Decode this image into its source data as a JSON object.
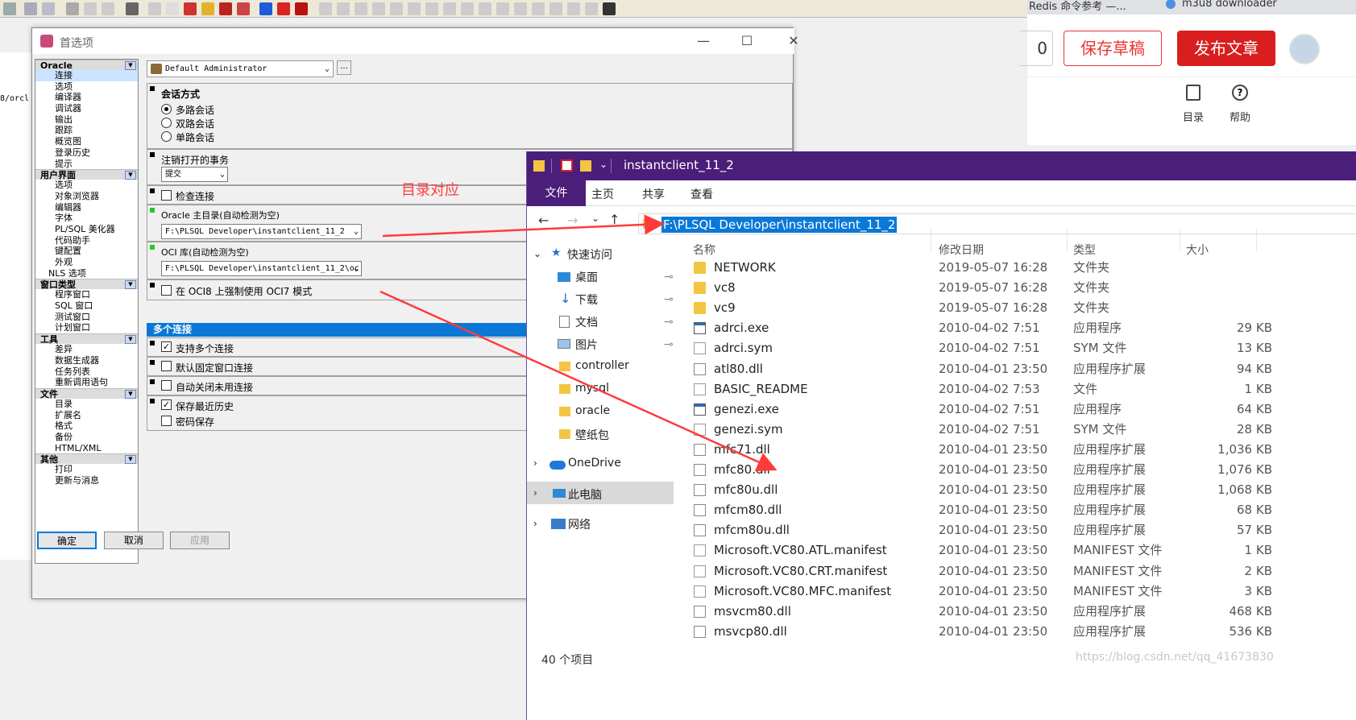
{
  "browser": {
    "tab1": "Redis 命令参考 —...",
    "tab2": "m3u8 downloader",
    "draft_label": "保存草稿",
    "publish_label": "发布文章",
    "toc_label": "目录",
    "help_label": "帮助",
    "partial_text": "0"
  },
  "left_strip_text": "8/orcl",
  "pref": {
    "title": "首选项",
    "profile": "Default Administrator",
    "profile_btn": "...",
    "tree": [
      {
        "cat": "Oracle",
        "items": [
          "连接",
          "选项",
          "编译器",
          "调试器",
          "输出",
          "跟踪",
          "概览图",
          "登录历史",
          "提示"
        ]
      },
      {
        "cat": "用户界面",
        "items": [
          "选项",
          "对象浏览器",
          "编辑器",
          "字体",
          "PL/SQL 美化器",
          "代码助手",
          "键配置",
          "外观",
          "NLS 选项"
        ]
      },
      {
        "cat": "窗口类型",
        "items": [
          "程序窗口",
          "SQL 窗口",
          "测试窗口",
          "计划窗口"
        ]
      },
      {
        "cat": "工具",
        "items": [
          "差异",
          "数据生成器",
          "任务列表",
          "重新调用语句"
        ]
      },
      {
        "cat": "文件",
        "items": [
          "目录",
          "扩展名",
          "格式",
          "备份",
          "HTML/XML"
        ]
      },
      {
        "cat": "其他",
        "items": [
          "打印",
          "更新与消息"
        ]
      }
    ],
    "session_title": "会话方式",
    "session_opts": [
      "多路会话",
      "双路会话",
      "单路会话"
    ],
    "commit_title": "注销打开的事务",
    "commit_value": "提交",
    "check_conn": "检查连接",
    "oracle_home_label": "Oracle 主目录(自动检测为空)",
    "oracle_home_value": "F:\\PLSQL Developer\\instantclient_11_2",
    "oci_label": "OCI 库(自动检测为空)",
    "oci_value": "F:\\PLSQL Developer\\instantclient_11_2\\oc",
    "force_oci7": "在 OCI8 上强制使用 OCI7 模式",
    "multi_header": "多个连接",
    "support_multi": "支持多个连接",
    "default_fixed": "默认固定窗口连接",
    "auto_close": "自动关闭未用连接",
    "save_history": "保存最近历史",
    "pwd_save": "密码保存",
    "ok": "确定",
    "cancel": "取消",
    "apply": "应用"
  },
  "annotation": "目录对应",
  "explorer": {
    "title": "instantclient_11_2",
    "ribbon": [
      "文件",
      "主页",
      "共享",
      "查看"
    ],
    "address": "F:\\PLSQL Developer\\instantclient_11_2",
    "columns": [
      "名称",
      "修改日期",
      "类型",
      "大小"
    ],
    "nav": {
      "quick": "快速访问",
      "pinned": [
        "桌面",
        "下载",
        "文档",
        "图片"
      ],
      "folders": [
        "controller",
        "mysql",
        "oracle",
        "壁纸包"
      ],
      "onedrive": "OneDrive",
      "thispc": "此电脑",
      "network": "网络"
    },
    "files": [
      {
        "name": "NETWORK",
        "date": "2019-05-07 16:28",
        "type": "文件夹",
        "size": "",
        "icon": "folder-icon"
      },
      {
        "name": "vc8",
        "date": "2019-05-07 16:28",
        "type": "文件夹",
        "size": "",
        "icon": "folder-icon"
      },
      {
        "name": "vc9",
        "date": "2019-05-07 16:28",
        "type": "文件夹",
        "size": "",
        "icon": "folder-icon"
      },
      {
        "name": "adrci.exe",
        "date": "2010-04-02 7:51",
        "type": "应用程序",
        "size": "29 KB",
        "icon": "exe-icon"
      },
      {
        "name": "adrci.sym",
        "date": "2010-04-02 7:51",
        "type": "SYM 文件",
        "size": "13 KB",
        "icon": "file-icon"
      },
      {
        "name": "atl80.dll",
        "date": "2010-04-01 23:50",
        "type": "应用程序扩展",
        "size": "94 KB",
        "icon": "dll-icon"
      },
      {
        "name": "BASIC_README",
        "date": "2010-04-02 7:53",
        "type": "文件",
        "size": "1 KB",
        "icon": "file-icon"
      },
      {
        "name": "genezi.exe",
        "date": "2010-04-02 7:51",
        "type": "应用程序",
        "size": "64 KB",
        "icon": "exe-icon"
      },
      {
        "name": "genezi.sym",
        "date": "2010-04-02 7:51",
        "type": "SYM 文件",
        "size": "28 KB",
        "icon": "file-icon"
      },
      {
        "name": "mfc71.dll",
        "date": "2010-04-01 23:50",
        "type": "应用程序扩展",
        "size": "1,036 KB",
        "icon": "dll-icon"
      },
      {
        "name": "mfc80.dll",
        "date": "2010-04-01 23:50",
        "type": "应用程序扩展",
        "size": "1,076 KB",
        "icon": "dll-icon"
      },
      {
        "name": "mfc80u.dll",
        "date": "2010-04-01 23:50",
        "type": "应用程序扩展",
        "size": "1,068 KB",
        "icon": "dll-icon"
      },
      {
        "name": "mfcm80.dll",
        "date": "2010-04-01 23:50",
        "type": "应用程序扩展",
        "size": "68 KB",
        "icon": "dll-icon"
      },
      {
        "name": "mfcm80u.dll",
        "date": "2010-04-01 23:50",
        "type": "应用程序扩展",
        "size": "57 KB",
        "icon": "dll-icon"
      },
      {
        "name": "Microsoft.VC80.ATL.manifest",
        "date": "2010-04-01 23:50",
        "type": "MANIFEST 文件",
        "size": "1 KB",
        "icon": "file-icon"
      },
      {
        "name": "Microsoft.VC80.CRT.manifest",
        "date": "2010-04-01 23:50",
        "type": "MANIFEST 文件",
        "size": "2 KB",
        "icon": "file-icon"
      },
      {
        "name": "Microsoft.VC80.MFC.manifest",
        "date": "2010-04-01 23:50",
        "type": "MANIFEST 文件",
        "size": "3 KB",
        "icon": "file-icon"
      },
      {
        "name": "msvcm80.dll",
        "date": "2010-04-01 23:50",
        "type": "应用程序扩展",
        "size": "468 KB",
        "icon": "dll-icon"
      },
      {
        "name": "msvcp80.dll",
        "date": "2010-04-01 23:50",
        "type": "应用程序扩展",
        "size": "536 KB",
        "icon": "dll-icon"
      }
    ],
    "status": "40 个项目"
  },
  "watermark": "https://blog.csdn.net/qq_41673830",
  "colors": {
    "accent": "#0a78d7",
    "explorer_title": "#4b1e7a",
    "annotation": "#ff3b3b",
    "publish": "#d81e1e"
  }
}
